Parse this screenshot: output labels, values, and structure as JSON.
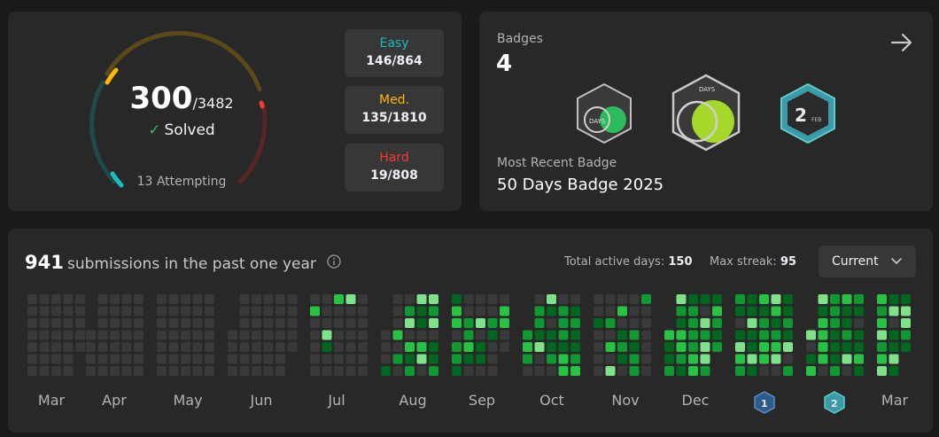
{
  "progress": {
    "solved": "300",
    "total": "/3482",
    "solved_label": "Solved",
    "attempting": "13 Attempting",
    "difficulties": [
      {
        "label": "Easy",
        "value": "146/864",
        "color": "#1cbaba"
      },
      {
        "label": "Med.",
        "value": "135/1810",
        "color": "#ffb800"
      },
      {
        "label": "Hard",
        "value": "19/808",
        "color": "#f63737"
      }
    ]
  },
  "badges": {
    "title": "Badges",
    "count": "4",
    "badge_texts": [
      "DAYS",
      "DAYS",
      "2",
      "FEB"
    ],
    "recent_label": "Most Recent Badge",
    "recent_name": "50 Days Badge 2025"
  },
  "calendar": {
    "submissions": "941",
    "submissions_text": "submissions in the past one year",
    "active_days_label": "Total active days:",
    "active_days": "150",
    "max_streak_label": "Max streak:",
    "max_streak": "95",
    "dropdown_value": "Current",
    "months": [
      "Mar",
      "Apr",
      "May",
      "Jun",
      "Jul",
      "Aug",
      "Sep",
      "Oct",
      "Nov",
      "Dec",
      "Mar"
    ],
    "month_badges": [
      "1",
      "2"
    ],
    "colors": {
      "empty": "#393939",
      "l1": "#016620",
      "l2": "#28c244",
      "l3": "#7fe18b",
      "l4": "#109932"
    }
  }
}
